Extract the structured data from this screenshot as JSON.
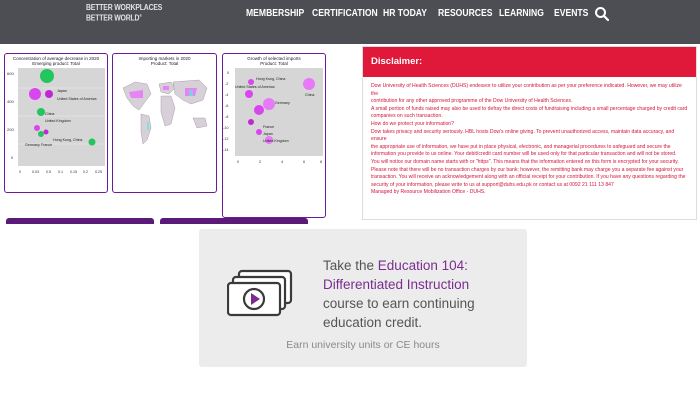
{
  "header": {
    "logo_line1": "BETTER WORKPLACES",
    "logo_line2": "BETTER WORLD",
    "logo_mark": "®",
    "nav": [
      "MEMBERSHIP",
      "CERTIFICATION",
      "HR TODAY",
      "RESOURCES",
      "LEARNING",
      "EVENTS"
    ],
    "search_icon": "search-icon"
  },
  "panels": [
    {
      "title_line1": "Concentration of average decrease in 2020",
      "title_line2": "Emerging product: Total",
      "labels": [
        "Japan",
        "United States of America",
        "China",
        "United Kingdom",
        "Germany",
        "France",
        "Hong Kong, China"
      ],
      "y_ticks": [
        "600",
        "400",
        "200",
        "0"
      ],
      "x_ticks": [
        "0",
        "0.03",
        "0.5",
        "0.1",
        "0.15",
        "0.2",
        "0.25"
      ]
    },
    {
      "title_line1": "Importing markets in 2020",
      "title_line2": "Product: Total"
    },
    {
      "title_line1": "Growth of selected imports",
      "title_line2": "Product: Total",
      "labels": [
        "Hong Kong, China",
        "United States of America",
        "Germany",
        "France",
        "Japan",
        "United Kingdom",
        "China"
      ],
      "y_ticks": [
        "0",
        "-2",
        "-4",
        "-6",
        "-8",
        "-10",
        "-12",
        "-14"
      ],
      "x_ticks": [
        "0",
        "2",
        "4",
        "6",
        "8"
      ]
    }
  ],
  "disclaimer": {
    "title": "Disclaimer:",
    "lines": [
      "Dow University of Health Sciences (DUHS) endeavor to utilize your contribution as per your preference indicated. However, we may utilize the",
      "contribution for any other approved programme of the Dow University of Health Sciences.",
      "A small portion of funds raised may also be used to defray the direct costs of fundraising including a small percentage charged by credit card",
      "companies on such transaction.",
      "How do we protect your information?",
      "Dow takes privacy and security seriously. HBL hosts Dow's online giving. To prevent unauthorized access, maintain data accuracy, and ensure",
      "the appropriate use of information, we have put in place physical, electronic, and managerial procedures to safeguard and secure the",
      "information you provide to us online. Your debit/credit card number will be used only for that particular transaction and will not be stored.",
      "You will notice our domain name starts with or \"https\". This means that the information entered on this form is encrypted for your security.",
      "Please note that there will be no transaction charges by our bank; however, the remitting bank may charge you a separate fee against your",
      "transaction. You will receive an acknowledgement along with an official receipt for your contribution. If you have any questions regarding the",
      "security of your information, please write to us at support@duhs.edu.pk or contact us at 0092 21 111 13 847",
      "Managed by Resource Mobilization Office - DUHS."
    ]
  },
  "promo": {
    "text_pre": "Take the ",
    "course_name": "Education 104: Differentiated Instruction",
    "text_post": " course to earn continuing education credit.",
    "subtext": "Earn university units or CE hours",
    "icon": "video-lesson-icon"
  }
}
